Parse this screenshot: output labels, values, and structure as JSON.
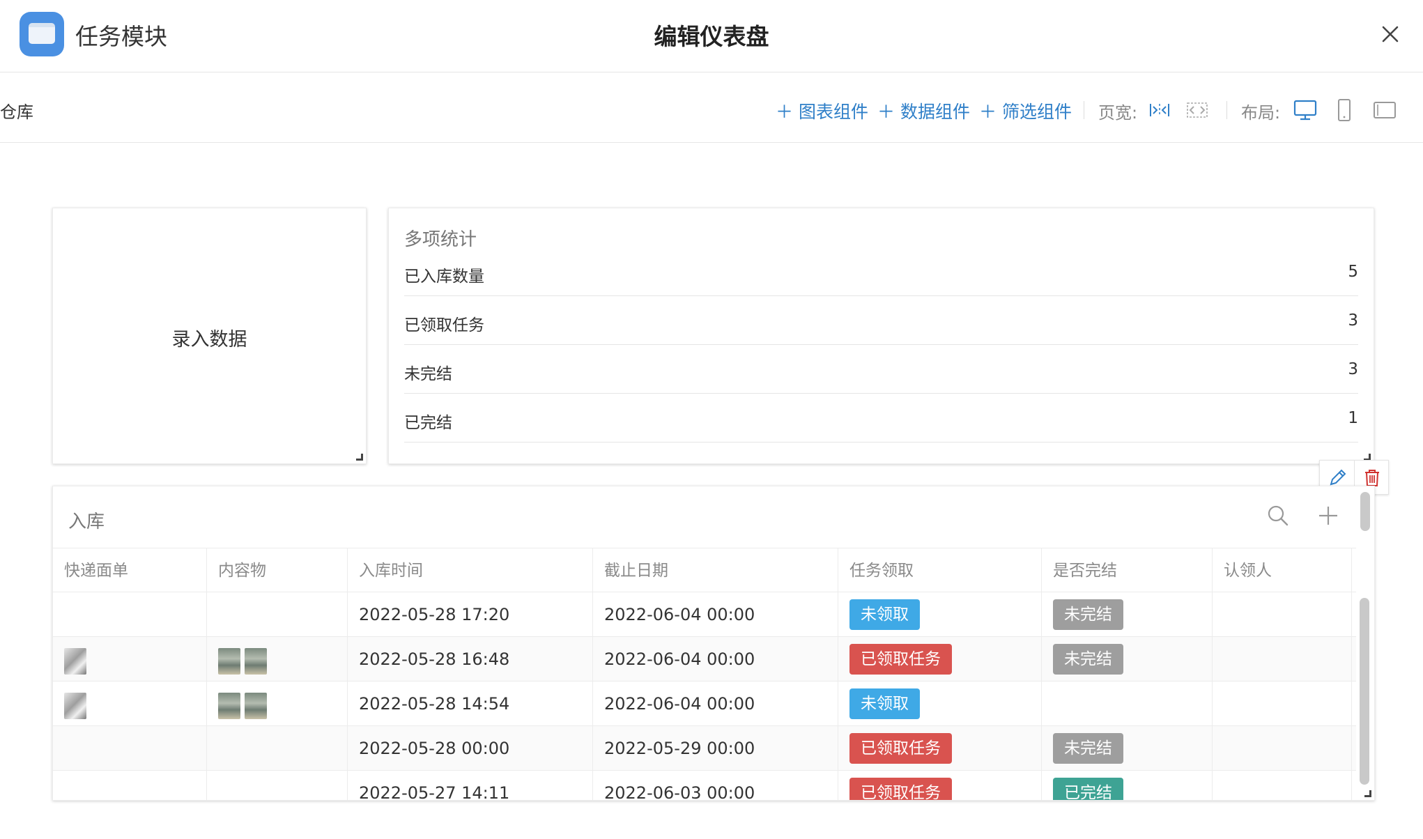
{
  "header": {
    "app_title": "任务模块",
    "page_title": "编辑仪表盘"
  },
  "toolbar": {
    "breadcrumb": "仓库",
    "add_chart": "图表组件",
    "add_data": "数据组件",
    "add_filter": "筛选组件",
    "page_width_label": "页宽:",
    "layout_label": "布局:"
  },
  "entry_card": {
    "label": "录入数据"
  },
  "stats_card": {
    "title": "多项统计",
    "rows": [
      {
        "label": "已入库数量",
        "value": "5"
      },
      {
        "label": "已领取任务",
        "value": "3"
      },
      {
        "label": "未完结",
        "value": "3"
      },
      {
        "label": "已完结",
        "value": "1"
      }
    ]
  },
  "table_card": {
    "title": "入库",
    "columns": [
      "快递面单",
      "内容物",
      "入库时间",
      "截止日期",
      "任务领取",
      "是否完结",
      "认领人"
    ],
    "rows": [
      {
        "inbound_time": "2022-05-28 17:20",
        "deadline": "2022-06-04 00:00",
        "task": "未领取",
        "done": "未完结"
      },
      {
        "inbound_time": "2022-05-28 16:48",
        "deadline": "2022-06-04 00:00",
        "task": "已领取任务",
        "done": "未完结"
      },
      {
        "inbound_time": "2022-05-28 14:54",
        "deadline": "2022-06-04 00:00",
        "task": "未领取",
        "done": ""
      },
      {
        "inbound_time": "2022-05-28 00:00",
        "deadline": "2022-05-29 00:00",
        "task": "已领取任务",
        "done": "未完结"
      },
      {
        "inbound_time": "2022-05-27 14:11",
        "deadline": "2022-06-03 00:00",
        "task": "已领取任务",
        "done": "已完结"
      }
    ]
  },
  "colors": {
    "accent": "#2f7fc8",
    "tag_unclaimed": "#3fa9e6",
    "tag_claimed": "#d9534f",
    "tag_open": "#9e9e9e",
    "tag_done": "#3ea394"
  }
}
